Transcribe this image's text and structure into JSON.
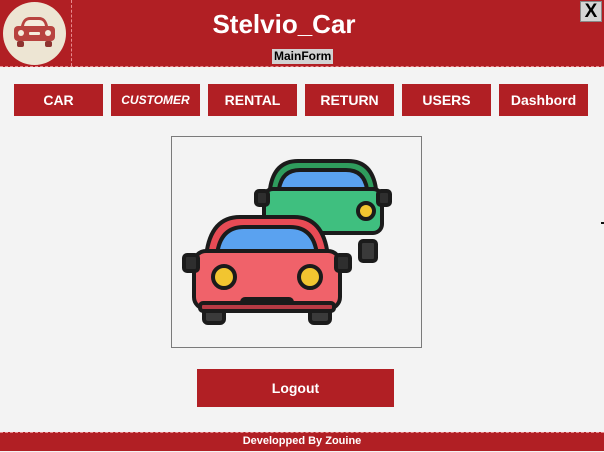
{
  "header": {
    "title": "Stelvio_Car",
    "subtitle": "MainForm",
    "close_label": "X",
    "logo_icon": "car-logo-icon",
    "color": "#b11f24"
  },
  "nav": {
    "items": [
      {
        "label": "CAR"
      },
      {
        "label": "CUSTOMER"
      },
      {
        "label": "RENTAL"
      },
      {
        "label": "RETURN"
      },
      {
        "label": "USERS"
      },
      {
        "label": "Dashbord"
      }
    ]
  },
  "main": {
    "image_icon": "cars-illustration-icon"
  },
  "logout_label": "Logout",
  "footer": {
    "text": "Developped By Zouine"
  }
}
